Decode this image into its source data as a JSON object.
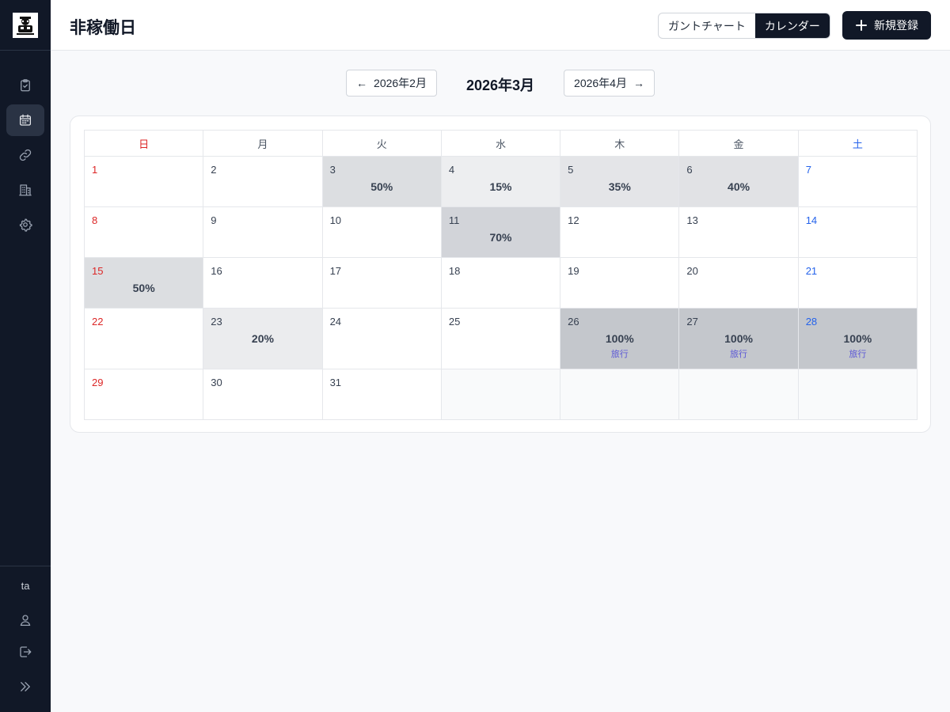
{
  "sidebar": {
    "nav": [
      {
        "name": "tasks",
        "icon": "clipboard-check-icon",
        "active": false
      },
      {
        "name": "calendar",
        "icon": "calendar-icon",
        "active": true
      },
      {
        "name": "links",
        "icon": "link-icon",
        "active": false
      },
      {
        "name": "company",
        "icon": "building-icon",
        "active": false
      },
      {
        "name": "settings",
        "icon": "gear-icon",
        "active": false
      }
    ],
    "user": "ta"
  },
  "header": {
    "title": "非稼働日",
    "view_gantt": "ガントチャート",
    "view_calendar": "カレンダー",
    "active_view": "calendar",
    "new_label": "新規登録"
  },
  "nav": {
    "prev_arrow": "←",
    "prev_label": "2026年2月",
    "current": "2026年3月",
    "next_label": "2026年4月",
    "next_arrow": "→"
  },
  "weekdays": [
    "日",
    "月",
    "火",
    "水",
    "木",
    "金",
    "土"
  ],
  "weeks": [
    [
      {
        "day": "1",
        "pct": "",
        "note": ""
      },
      {
        "day": "2",
        "pct": "",
        "note": ""
      },
      {
        "day": "3",
        "pct": "50%",
        "note": ""
      },
      {
        "day": "4",
        "pct": "15%",
        "note": ""
      },
      {
        "day": "5",
        "pct": "35%",
        "note": ""
      },
      {
        "day": "6",
        "pct": "40%",
        "note": ""
      },
      {
        "day": "7",
        "pct": "",
        "note": ""
      }
    ],
    [
      {
        "day": "8",
        "pct": "",
        "note": ""
      },
      {
        "day": "9",
        "pct": "",
        "note": ""
      },
      {
        "day": "10",
        "pct": "",
        "note": ""
      },
      {
        "day": "11",
        "pct": "70%",
        "note": ""
      },
      {
        "day": "12",
        "pct": "",
        "note": ""
      },
      {
        "day": "13",
        "pct": "",
        "note": ""
      },
      {
        "day": "14",
        "pct": "",
        "note": ""
      }
    ],
    [
      {
        "day": "15",
        "pct": "50%",
        "note": ""
      },
      {
        "day": "16",
        "pct": "",
        "note": ""
      },
      {
        "day": "17",
        "pct": "",
        "note": ""
      },
      {
        "day": "18",
        "pct": "",
        "note": ""
      },
      {
        "day": "19",
        "pct": "",
        "note": ""
      },
      {
        "day": "20",
        "pct": "",
        "note": ""
      },
      {
        "day": "21",
        "pct": "",
        "note": ""
      }
    ],
    [
      {
        "day": "22",
        "pct": "",
        "note": ""
      },
      {
        "day": "23",
        "pct": "20%",
        "note": ""
      },
      {
        "day": "24",
        "pct": "",
        "note": ""
      },
      {
        "day": "25",
        "pct": "",
        "note": ""
      },
      {
        "day": "26",
        "pct": "100%",
        "note": "旅行"
      },
      {
        "day": "27",
        "pct": "100%",
        "note": "旅行"
      },
      {
        "day": "28",
        "pct": "100%",
        "note": "旅行"
      }
    ],
    [
      {
        "day": "29",
        "pct": "",
        "note": ""
      },
      {
        "day": "30",
        "pct": "",
        "note": ""
      },
      {
        "day": "31",
        "pct": "",
        "note": ""
      },
      null,
      null,
      null,
      null
    ]
  ],
  "colors": {
    "sidebar_bg": "#111827",
    "sunday": "#dc2626",
    "saturday": "#2563eb",
    "note": "#5b57d6",
    "cell_fill_base": "#6b7280"
  }
}
